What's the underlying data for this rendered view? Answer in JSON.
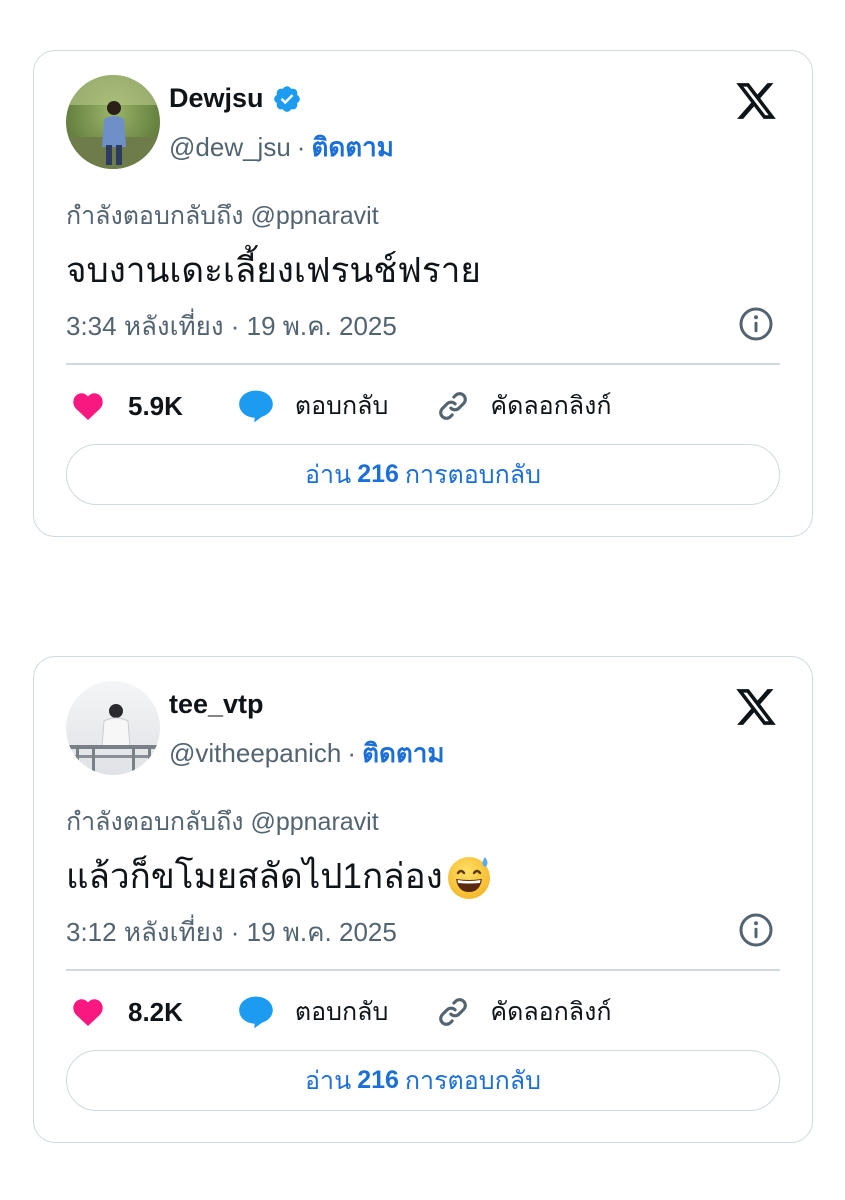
{
  "tweets": [
    {
      "display_name": "Dewjsu",
      "verified": true,
      "handle": "@dew_jsu",
      "separator": "·",
      "follow_label": "ติดตาม",
      "reply_prefix": "กำลังตอบกลับถึง",
      "reply_to": "@ppnaravit",
      "text": "จบงานเดะเลี้ยงเฟรนช์ฟราย",
      "has_emoji": false,
      "timestamp": "3:34 หลังเที่ยง · 19 พ.ค. 2025",
      "likes": "5.9K",
      "reply_label": "ตอบกลับ",
      "copy_link_label": "คัดลอกลิงก์",
      "read_prefix": "อ่าน",
      "read_count": "216",
      "read_suffix": "การตอบกลับ"
    },
    {
      "display_name": "tee_vtp",
      "verified": false,
      "handle": "@vitheepanich",
      "separator": "·",
      "follow_label": "ติดตาม",
      "reply_prefix": "กำลังตอบกลับถึง",
      "reply_to": "@ppnaravit",
      "text": "แล้วก็ขโมยสลัดไป1กล่อง",
      "has_emoji": true,
      "emoji_name": "grinning-face-with-sweat-emoji",
      "timestamp": "3:12 หลังเที่ยง · 19 พ.ค. 2025",
      "likes": "8.2K",
      "reply_label": "ตอบกลับ",
      "copy_link_label": "คัดลอกลิงก์",
      "read_prefix": "อ่าน",
      "read_count": "216",
      "read_suffix": "การตอบกลับ"
    }
  ],
  "icons": {
    "verified": "verified-badge-icon",
    "x_logo": "x-logo-icon",
    "info": "info-icon",
    "like": "heart-icon",
    "reply": "speech-bubble-icon",
    "copy_link": "link-icon"
  },
  "colors": {
    "accent": "#1d6fd8",
    "verified": "#1d9bf0",
    "like": "#f91880",
    "muted_text": "#536471",
    "border": "#cfd9de"
  }
}
